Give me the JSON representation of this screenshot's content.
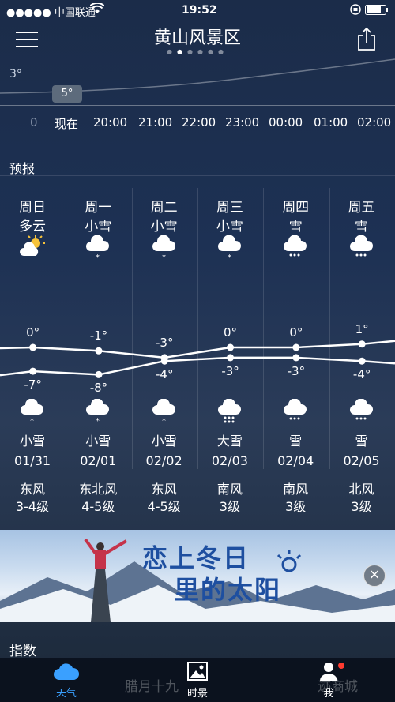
{
  "status_bar": {
    "carrier": "●●●●● 中国联通",
    "time": "19:52",
    "battery_icon": "battery-icon"
  },
  "header": {
    "title": "黄山风景区"
  },
  "hourly": {
    "temp_label": "3°",
    "bubble": "5°",
    "zero": "0",
    "hours": [
      "现在",
      "20:00",
      "21:00",
      "22:00",
      "23:00",
      "00:00",
      "01:00",
      "02:00"
    ]
  },
  "forecast": {
    "label": "预报",
    "days": [
      {
        "day": "周日",
        "cond": "多云",
        "high": "0°",
        "low": "-7°",
        "cond2": "小雪",
        "date": "01/31",
        "wind_dir": "东风",
        "wind_lvl": "3-4级",
        "icon_top": "partly-cloudy-icon",
        "icon_bottom": "light-snow-icon"
      },
      {
        "day": "周一",
        "cond": "小雪",
        "high": "-1°",
        "low": "-8°",
        "cond2": "小雪",
        "date": "02/01",
        "wind_dir": "东北风",
        "wind_lvl": "4-5级",
        "icon_top": "light-snow-icon",
        "icon_bottom": "light-snow-icon"
      },
      {
        "day": "周二",
        "cond": "小雪",
        "high": "-3°",
        "low": "-4°",
        "cond2": "小雪",
        "date": "02/02",
        "wind_dir": "东风",
        "wind_lvl": "4-5级",
        "icon_top": "light-snow-icon",
        "icon_bottom": "light-snow-icon"
      },
      {
        "day": "周三",
        "cond": "小雪",
        "high": "0°",
        "low": "-3°",
        "cond2": "大雪",
        "date": "02/03",
        "wind_dir": "南风",
        "wind_lvl": "3级",
        "icon_top": "light-snow-icon",
        "icon_bottom": "heavy-snow-icon"
      },
      {
        "day": "周四",
        "cond": "雪",
        "high": "0°",
        "low": "-3°",
        "cond2": "雪",
        "date": "02/04",
        "wind_dir": "南风",
        "wind_lvl": "3级",
        "icon_top": "snow-icon",
        "icon_bottom": "snow-icon"
      },
      {
        "day": "周五",
        "cond": "雪",
        "high": "1°",
        "low": "-4°",
        "cond2": "雪",
        "date": "02/05",
        "wind_dir": "北风",
        "wind_lvl": "3级",
        "icon_top": "snow-icon",
        "icon_bottom": "snow-icon"
      }
    ],
    "high_values": [
      0,
      -1,
      -3,
      0,
      0,
      1
    ],
    "low_values": [
      -7,
      -8,
      -4,
      -3,
      -3,
      -4
    ]
  },
  "ad": {
    "line1": "恋上冬日",
    "line2": "里的太阳"
  },
  "index": {
    "label": "指数"
  },
  "tabbar": {
    "tabs": [
      {
        "label": "天气",
        "icon": "cloud-icon",
        "active": true
      },
      {
        "label": "时景",
        "icon": "photo-icon",
        "active": false
      },
      {
        "label": "我",
        "icon": "person-icon",
        "active": false
      }
    ],
    "ghost_left": "腊月十九",
    "ghost_right": "迹商城"
  },
  "colors": {
    "active_tab": "#3aa0ff",
    "ad_text": "#1e4fa0",
    "badge": "#ff3b30"
  }
}
